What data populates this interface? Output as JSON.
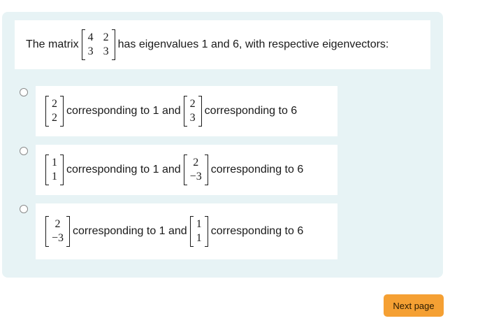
{
  "question": {
    "prefix": "The matrix",
    "matrix": [
      [
        "4",
        "2"
      ],
      [
        "3",
        "3"
      ]
    ],
    "suffix": "has eigenvalues 1 and 6, with respective eigenvectors:"
  },
  "options": [
    {
      "v1": [
        "2",
        "2"
      ],
      "mid": "corresponding to 1 and",
      "v2": [
        "2",
        "3"
      ],
      "end": "corresponding to 6",
      "selected": false
    },
    {
      "v1": [
        "1",
        "1"
      ],
      "mid": "corresponding to 1 and",
      "v2": [
        "2",
        "−3"
      ],
      "end": "corresponding to 6",
      "selected": false
    },
    {
      "v1": [
        "2",
        "−3"
      ],
      "mid": "corresponding to 1 and",
      "v2": [
        "1",
        "1"
      ],
      "end": "corresponding to 6",
      "selected": false
    }
  ],
  "next_button": {
    "label": "Next page",
    "color": "#f5a033"
  },
  "colors": {
    "panel": "#e7f3f5",
    "card": "#ffffff"
  }
}
